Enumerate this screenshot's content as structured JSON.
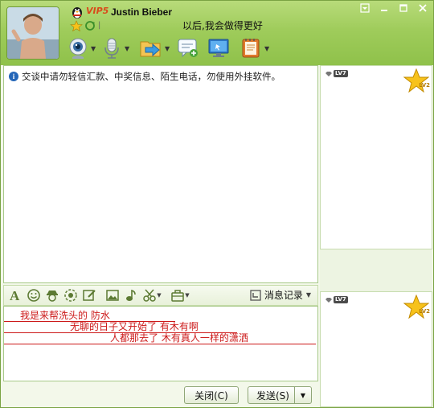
{
  "contact": {
    "nickname": "Justin Bieber",
    "vip_label": "VIP5",
    "signature": "以后,我会做得更好"
  },
  "window_controls": [
    {
      "name": "skin-menu-icon"
    },
    {
      "name": "minimize-icon"
    },
    {
      "name": "maximize-icon"
    },
    {
      "name": "close-icon"
    }
  ],
  "main_toolbar": [
    {
      "name": "video-call-button",
      "icon": "webcam-icon"
    },
    {
      "name": "voice-call-button",
      "icon": "microphone-icon"
    },
    {
      "name": "send-file-button",
      "icon": "folder-arrow-icon"
    },
    {
      "name": "create-discussion-button",
      "icon": "chat-add-icon"
    },
    {
      "name": "remote-assist-button",
      "icon": "monitor-icon"
    },
    {
      "name": "app-menu-button",
      "icon": "notebook-icon"
    }
  ],
  "message_area": {
    "notice": "交谈中请勿轻信汇款、中奖信息、陌生电话，勿使用外挂软件。"
  },
  "input_toolbar": {
    "tools": [
      "font-icon",
      "emoji-icon",
      "magic-face-icon",
      "nudge-icon",
      "doodle-icon",
      "image-icon",
      "music-icon",
      "screenshot-icon",
      "toolbox-icon"
    ],
    "history_label": "消息记录"
  },
  "input_area": {
    "lines": [
      "我是来帮洗头的            防水",
      "无聊的日子又开始了   有木有啊",
      "人都那去了        木有真人一样的潇洒"
    ]
  },
  "buttons": {
    "close_label": "关闭(C)",
    "send_label": "发送(S)"
  },
  "side_panel": {
    "top_level_badge": "LV7",
    "top_star_label": "LV2",
    "bottom_level_badge": "LV7",
    "bottom_star_label": "LV2"
  },
  "colors": {
    "header_green": "#9fcc5b",
    "input_text_red": "#cc1a1a",
    "vip_orange": "#d94a1a"
  }
}
